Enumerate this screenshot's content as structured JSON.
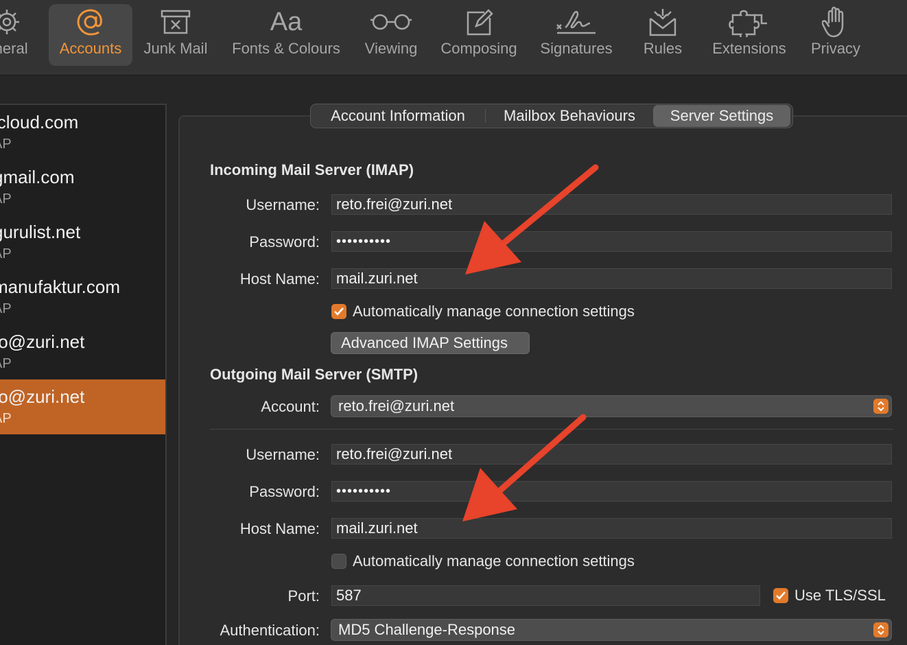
{
  "toolbar": {
    "items": [
      {
        "label": "eneral",
        "icon": "gear-icon"
      },
      {
        "label": "Accounts",
        "icon": "at-sign-icon"
      },
      {
        "label": "Junk Mail",
        "icon": "junk-mail-icon"
      },
      {
        "label": "Fonts & Colours",
        "icon": "fonts-icon",
        "glyph": "Aa"
      },
      {
        "label": "Viewing",
        "icon": "glasses-icon"
      },
      {
        "label": "Composing",
        "icon": "compose-icon"
      },
      {
        "label": "Signatures",
        "icon": "signature-icon"
      },
      {
        "label": "Rules",
        "icon": "rules-envelope-icon"
      },
      {
        "label": "Extensions",
        "icon": "puzzle-icon"
      },
      {
        "label": "Privacy",
        "icon": "hand-icon"
      }
    ],
    "active": "Accounts"
  },
  "sidebar": {
    "accounts": [
      {
        "name": "icloud.com",
        "type": "AP"
      },
      {
        "name": "gmail.com",
        "type": "AP"
      },
      {
        "name": "gurulist.net",
        "type": "AP"
      },
      {
        "name": "manufaktur.com",
        "type": "AP"
      },
      {
        "name": "fo@zuri.net",
        "type": "AP"
      },
      {
        "name": "to@zuri.net",
        "type": "AP"
      }
    ],
    "selected_index": 5
  },
  "tabs": {
    "items": [
      "Account Information",
      "Mailbox Behaviours",
      "Server Settings"
    ],
    "active": "Server Settings"
  },
  "incoming": {
    "title": "Incoming Mail Server (IMAP)",
    "username_label": "Username:",
    "username": "reto.frei@zuri.net",
    "password_label": "Password:",
    "password": "••••••••••",
    "host_label": "Host Name:",
    "host": "mail.zuri.net",
    "auto_manage_label": "Automatically manage connection settings",
    "auto_manage_checked": true,
    "advanced_button": "Advanced IMAP Settings"
  },
  "outgoing": {
    "title": "Outgoing Mail Server (SMTP)",
    "account_label": "Account:",
    "account": "reto.frei@zuri.net",
    "username_label": "Username:",
    "username": "reto.frei@zuri.net",
    "password_label": "Password:",
    "password": "••••••••••",
    "host_label": "Host Name:",
    "host": "mail.zuri.net",
    "auto_manage_label": "Automatically manage connection settings",
    "auto_manage_checked": false,
    "port_label": "Port:",
    "port": "587",
    "tls_label": "Use TLS/SSL",
    "tls_checked": true,
    "auth_label": "Authentication:",
    "auth": "MD5 Challenge-Response"
  },
  "colors": {
    "accent": "#e27a2b",
    "selection": "#bf6425",
    "annotation_arrow": "#e8432b"
  }
}
